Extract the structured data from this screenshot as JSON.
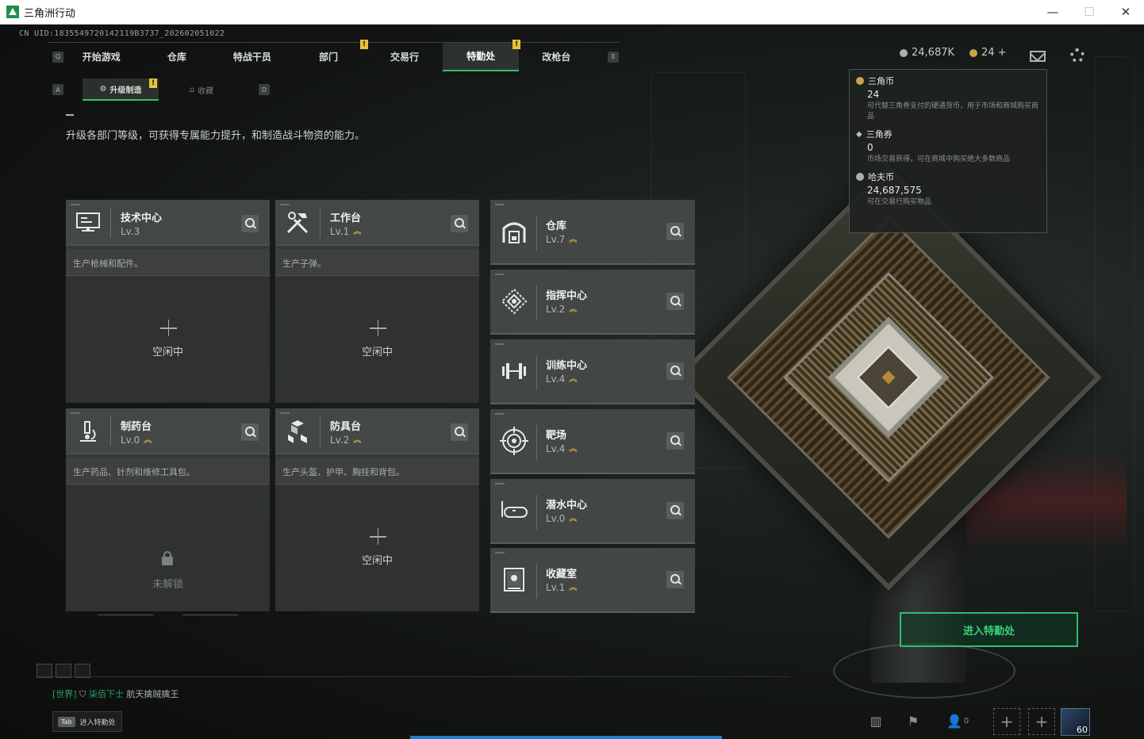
{
  "window": {
    "title": "三角洲行动",
    "min": "—",
    "max": "☐",
    "close": "✕"
  },
  "uid": "CN UID:1835549720142119B3737_202602051022",
  "nav": {
    "left_key": "Q",
    "right_key": "E",
    "items": [
      {
        "label": "开始游戏"
      },
      {
        "label": "仓库"
      },
      {
        "label": "特战干员"
      },
      {
        "label": "部门",
        "warn": "!"
      },
      {
        "label": "交易行"
      },
      {
        "label": "特勤处",
        "warn": "!",
        "active": true
      },
      {
        "label": "改枪台"
      }
    ]
  },
  "currency": {
    "coins": "24,687K",
    "tickets": "24 +"
  },
  "subtabs": {
    "left_key": "A",
    "right_key": "D",
    "items": [
      {
        "label": "升级制造",
        "warn": "!"
      },
      {
        "label": "收藏"
      }
    ]
  },
  "description": "升级各部门等级，可获得专属能力提升，和制造战斗物资的能力。",
  "cards": [
    {
      "name": "技术中心",
      "level": "Lv.3",
      "up": "",
      "desc": "生产枪械和配件。",
      "status": "空闲中",
      "icon": "computer-icon"
    },
    {
      "name": "工作台",
      "level": "Lv.1",
      "up": "︽",
      "desc": "生产子弹。",
      "status": "空闲中",
      "icon": "tools-icon"
    },
    {
      "name": "制药台",
      "level": "Lv.0",
      "up": "︽",
      "desc": "生产药品、针剂和维修工具包。",
      "status": "未解锁",
      "icon": "microscope-icon"
    },
    {
      "name": "防具台",
      "level": "Lv.2",
      "up": "︽",
      "desc": "生产头盔、护甲、胸挂和背包。",
      "status": "空闲中",
      "icon": "cubes-icon"
    }
  ],
  "rcards": [
    {
      "name": "仓库",
      "level": "Lv.7",
      "up": "︽",
      "icon": "warehouse-icon"
    },
    {
      "name": "指挥中心",
      "level": "Lv.2",
      "up": "︽",
      "icon": "command-icon"
    },
    {
      "name": "训练中心",
      "level": "Lv.4",
      "up": "︽",
      "icon": "dumbbell-icon"
    },
    {
      "name": "靶场",
      "level": "Lv.4",
      "up": "︽",
      "icon": "target-icon"
    },
    {
      "name": "潜水中心",
      "level": "Lv.0",
      "up": "︽",
      "icon": "diving-mask-icon"
    },
    {
      "name": "收藏室",
      "level": "Lv.1",
      "up": "︽",
      "icon": "collection-icon"
    }
  ],
  "tooltip": [
    {
      "name": "三角币",
      "value": "24",
      "desc": "可代替三角券支付的硬通货币，用于市场和商城购买商品",
      "color": "#c9a54a"
    },
    {
      "name": "三角券",
      "value": "0",
      "desc": "市场交易获得，可在商城中购买绝大多数商品",
      "color": "#b8bdb6"
    },
    {
      "name": "哈夫币",
      "value": "24,687,575",
      "desc": "可在交易行购买物品",
      "color": "#a9b0b5"
    }
  ],
  "enter_button": "进入特勤处",
  "chat": {
    "channel": "[世界]",
    "user": "柒佰下士",
    "message": "航天擒贼擒王"
  },
  "tab_hint": {
    "key": "Tab",
    "label": "进入特勤处"
  },
  "bottom": {
    "friends_count": "0",
    "player_level": "60"
  },
  "colors": {
    "accent": "#35c06f",
    "warn": "#e8c23a",
    "upgrade": "#c7a240"
  }
}
